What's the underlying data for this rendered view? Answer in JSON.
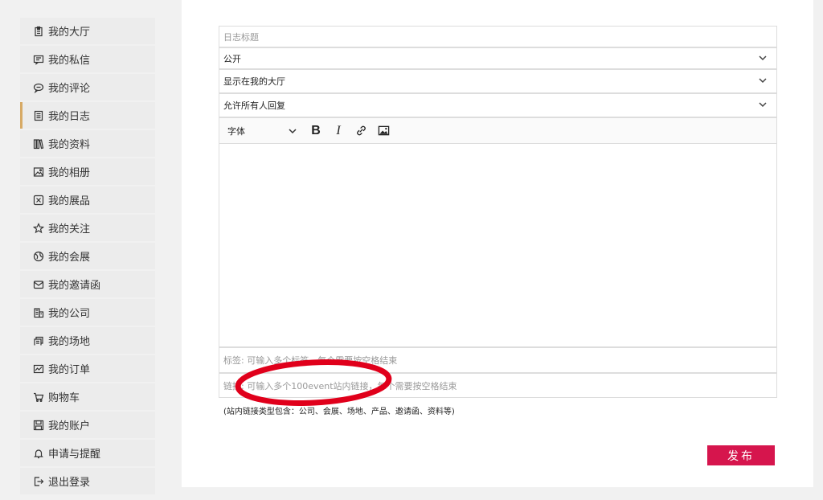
{
  "sidebar": {
    "items": [
      {
        "label": "我的大厅",
        "icon": "clipboard-icon"
      },
      {
        "label": "我的私信",
        "icon": "message-icon"
      },
      {
        "label": "我的评论",
        "icon": "comment-icon"
      },
      {
        "label": "我的日志",
        "icon": "log-icon",
        "active": true
      },
      {
        "label": "我的资料",
        "icon": "library-icon"
      },
      {
        "label": "我的相册",
        "icon": "image-icon"
      },
      {
        "label": "我的展品",
        "icon": "box-icon"
      },
      {
        "label": "我的关注",
        "icon": "star-icon"
      },
      {
        "label": "我的会展",
        "icon": "globe-icon"
      },
      {
        "label": "我的邀请函",
        "icon": "envelope-icon"
      },
      {
        "label": "我的公司",
        "icon": "building-icon"
      },
      {
        "label": "我的场地",
        "icon": "venue-icon"
      },
      {
        "label": "我的订单",
        "icon": "order-icon"
      },
      {
        "label": "购物车",
        "icon": "cart-icon"
      },
      {
        "label": "我的账户",
        "icon": "save-icon"
      },
      {
        "label": "申请与提醒",
        "icon": "bell-icon"
      },
      {
        "label": "退出登录",
        "icon": "logout-icon"
      }
    ]
  },
  "form": {
    "title_placeholder": "日志标题",
    "visibility": "公开",
    "display": "显示在我的大厅",
    "reply": "允许所有人回复",
    "toolbar": {
      "font_label": "字体",
      "bold_label": "B",
      "italic_label": "I"
    },
    "tags_placeholder": "标签: 可输入多个标签，每个需要按空格结束",
    "links_placeholder": "链接: 可输入多个100event站内链接，每个需要按空格结束",
    "hint": "(站内链接类型包含：公司、会展、场地、产品、邀请函、资料等)",
    "publish_label": "发布"
  },
  "colors": {
    "accent": "#d6154d",
    "active_marker": "#d7aa66",
    "annotation": "#e0001b"
  }
}
